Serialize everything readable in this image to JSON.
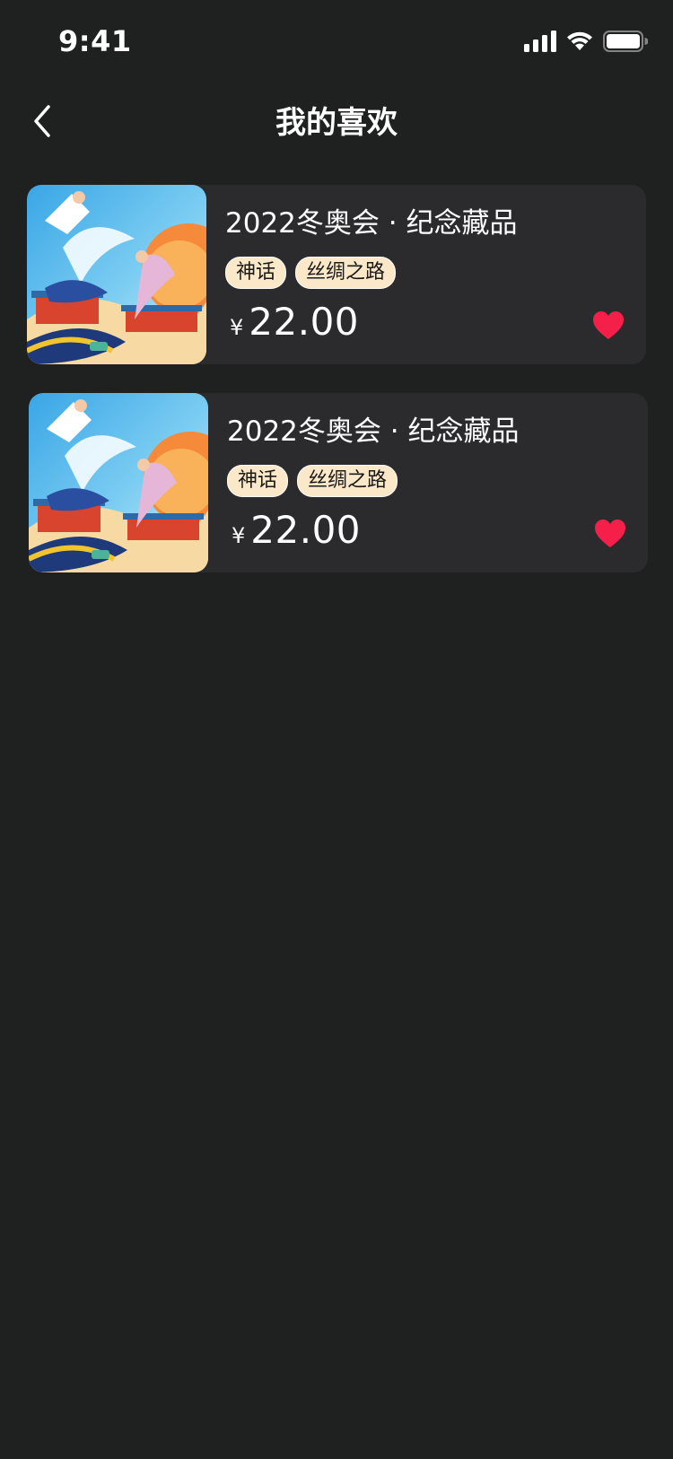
{
  "status_bar": {
    "time": "9:41",
    "icons": [
      "cellular-signal-icon",
      "wifi-icon",
      "battery-icon"
    ]
  },
  "nav": {
    "title": "我的喜欢",
    "back_icon": "chevron-left-icon"
  },
  "favorites": [
    {
      "title": "2022冬奥会 · 纪念藏品",
      "tags": [
        "神话",
        "丝绸之路"
      ],
      "currency_symbol": "¥",
      "price": "22.00",
      "liked": true
    },
    {
      "title": "2022冬奥会 · 纪念藏品",
      "tags": [
        "神话",
        "丝绸之路"
      ],
      "currency_symbol": "¥",
      "price": "22.00",
      "liked": true
    }
  ],
  "colors": {
    "background": "#1f2020",
    "card": "#2b2b2d",
    "tag_bg": "#fbe8c8",
    "heart": "#f5204a"
  }
}
